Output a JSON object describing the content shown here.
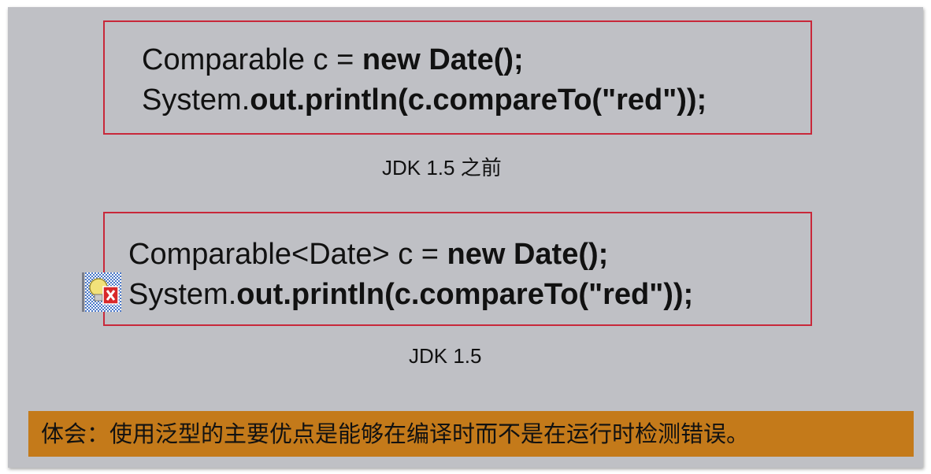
{
  "code_before": {
    "line1_plain": "Comparable c = ",
    "line1_bold": "new Date();",
    "line2_plain": "System.",
    "line2_bold": "out.println(c.compareTo(\"red\"));"
  },
  "caption_before": "JDK 1.5 之前",
  "code_after": {
    "line1_plain": "Comparable<Date> c = ",
    "line1_bold": "new Date();",
    "line2_plain": "System.",
    "line2_bold": "out.println(c.compareTo(\"red\"));"
  },
  "caption_after": "JDK 1.5",
  "banner_text": "体会：使用泛型的主要优点是能够在编译时而不是在运行时检测错误。",
  "colors": {
    "slide_bg": "#bfc0c5",
    "box_border": "#c8283a",
    "banner_bg": "#c47a1a"
  },
  "icons": [
    "error-lightbulb-icon"
  ]
}
